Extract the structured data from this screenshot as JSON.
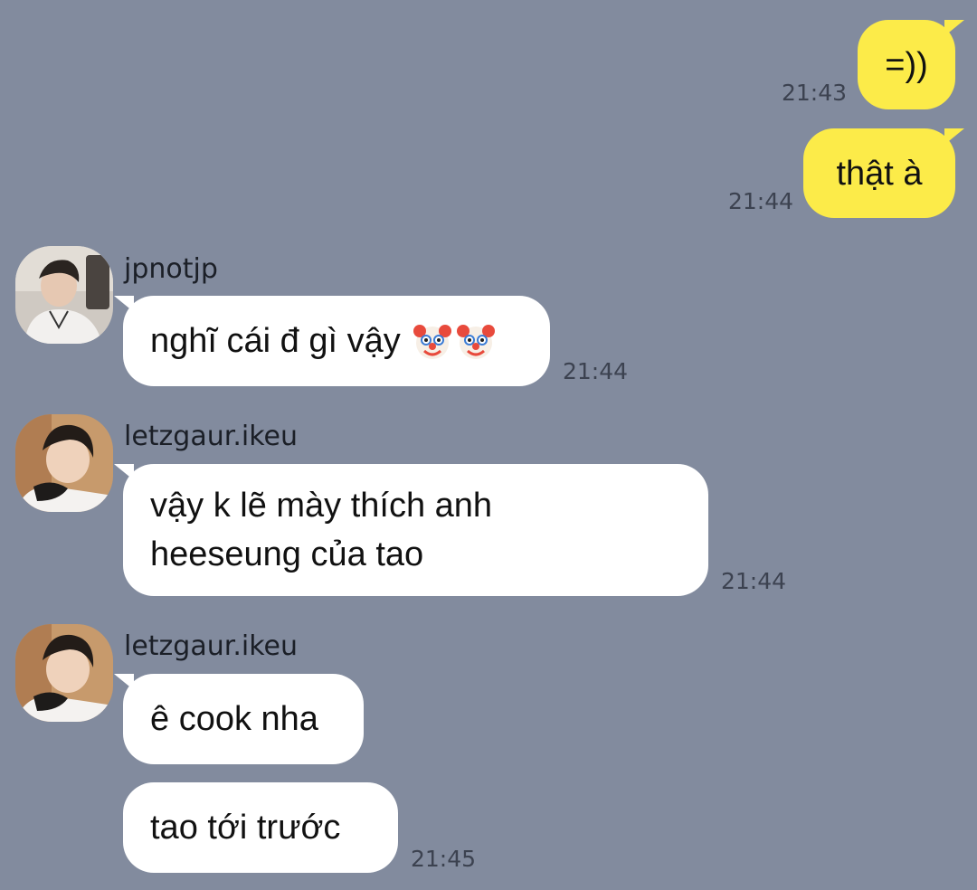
{
  "messages": [
    {
      "direction": "outgoing",
      "text": "=))",
      "time": "21:43"
    },
    {
      "direction": "outgoing",
      "text": "thật à",
      "time": "21:44"
    },
    {
      "direction": "incoming",
      "sender": "jpnotjp",
      "text": "nghĩ cái đ gì vậy",
      "emoji": [
        "clown-face",
        "clown-face"
      ],
      "time": "21:44"
    },
    {
      "direction": "incoming",
      "sender": "letzgaur.ikeu",
      "lines": [
        "vậy k lẽ mày thích anh",
        "heeseung của tao"
      ],
      "time": "21:44"
    },
    {
      "direction": "incoming",
      "sender": "letzgaur.ikeu",
      "text": "ê cook nha"
    },
    {
      "direction": "incoming",
      "text": "tao tới trước",
      "time": "21:45"
    }
  ],
  "colors": {
    "background": "#828b9e",
    "outgoing_bubble": "#fceb49",
    "incoming_bubble": "#ffffff"
  }
}
